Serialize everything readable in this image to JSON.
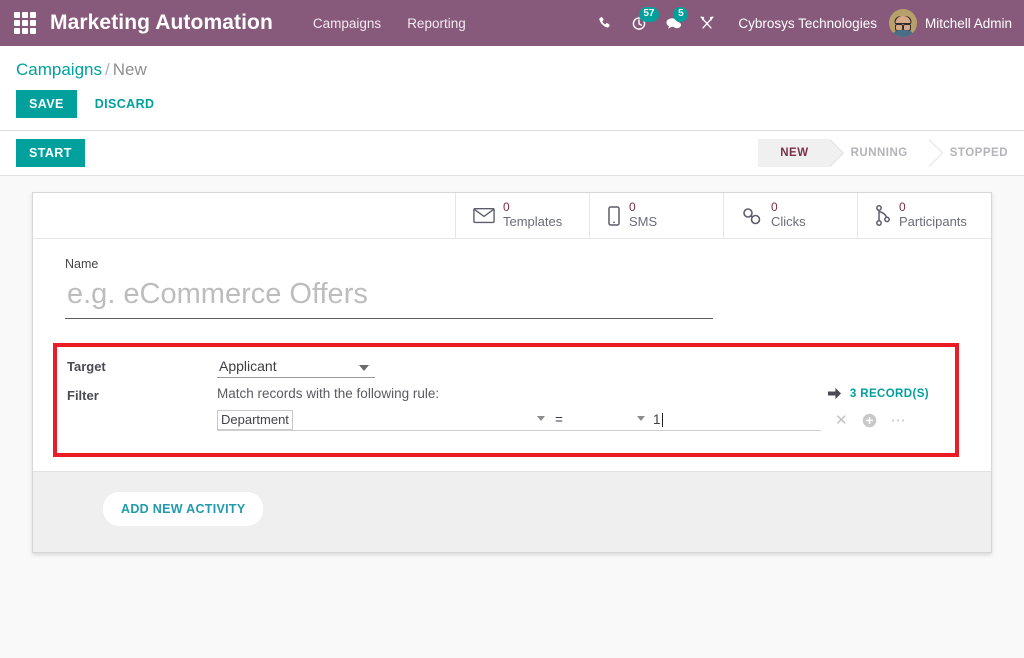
{
  "navbar": {
    "apps_icon": "apps-grid-icon",
    "app_title": "Marketing Automation",
    "menu": [
      {
        "label": "Campaigns"
      },
      {
        "label": "Reporting"
      }
    ],
    "icons": [
      {
        "name": "phone-icon",
        "badge": null
      },
      {
        "name": "activity-clock-icon",
        "badge": "57"
      },
      {
        "name": "messages-icon",
        "badge": "5"
      },
      {
        "name": "developer-tools-icon",
        "badge": null
      }
    ],
    "company": "Cybrosys Technologies",
    "user": "Mitchell Admin",
    "purple": "#875A7B",
    "teal": "#00A09D"
  },
  "breadcrumb": {
    "parent": "Campaigns",
    "separator": "/",
    "current": "New"
  },
  "actions": {
    "save": "SAVE",
    "discard": "DISCARD",
    "start": "START"
  },
  "statusbar": {
    "steps": [
      {
        "label": "NEW",
        "active": true
      },
      {
        "label": "RUNNING",
        "active": false
      },
      {
        "label": "STOPPED",
        "active": false
      }
    ],
    "active_color": "#7C2F4A"
  },
  "stat_buttons": [
    {
      "value": "0",
      "label": "Templates",
      "icon": "envelope-icon"
    },
    {
      "value": "0",
      "label": "SMS",
      "icon": "mobile-phone-icon"
    },
    {
      "value": "0",
      "label": "Clicks",
      "icon": "chain-link-icon"
    },
    {
      "value": "0",
      "label": "Participants",
      "icon": "code-branch-icon"
    }
  ],
  "form": {
    "name_label": "Name",
    "name_value": "",
    "name_placeholder": "e.g. eCommerce Offers"
  },
  "highlight": {
    "border_color": "#ec1c24",
    "target_label": "Target",
    "target_value": "Applicant",
    "target_options": [
      "Applicant"
    ],
    "filter_label": "Filter",
    "filter_description": "Match records with the following rule:",
    "records_count": "3 RECORD(S)",
    "records_arrow_icon": "arrow-right-icon",
    "rule": {
      "field": "Department",
      "operator": "=",
      "value": "1",
      "delete_icon": "remove-node-icon",
      "add_icon": "add-node-icon",
      "more_icon": "more-options-icon"
    }
  },
  "activity": {
    "add_button": "ADD NEW ACTIVITY"
  }
}
